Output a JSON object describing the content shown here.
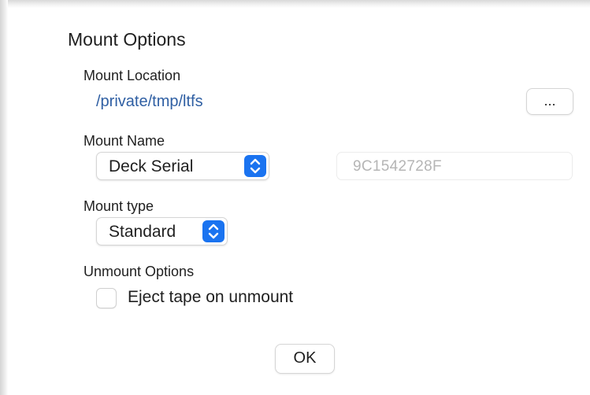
{
  "dialog": {
    "title": "Mount Options",
    "accent_color": "#1a73f0",
    "link_color": "#2f5fa3"
  },
  "mount_location": {
    "label": "Mount Location",
    "path": "/private/tmp/ltfs",
    "browse_label": "..."
  },
  "mount_name": {
    "label": "Mount Name",
    "selected": "Deck Serial",
    "field_value": "9C1542728F"
  },
  "mount_type": {
    "label": "Mount type",
    "selected": "Standard"
  },
  "unmount_options": {
    "label": "Unmount Options",
    "eject_label": "Eject tape on unmount",
    "eject_checked": false
  },
  "footer": {
    "ok_label": "OK"
  }
}
